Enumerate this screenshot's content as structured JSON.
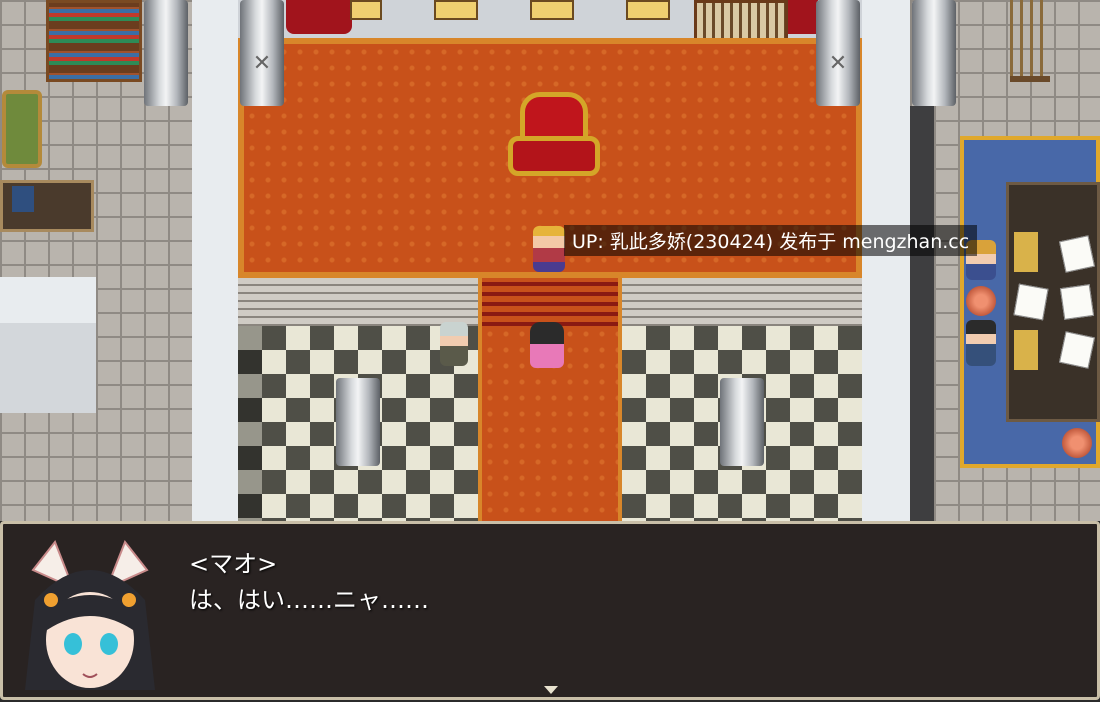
{
  "watermark": {
    "text": "UP: 乳此多娇(230424) 发布于 mengzhan.cc"
  },
  "message": {
    "speaker": "<マオ>",
    "line": "は、はい……ニャ……",
    "portrait_icon": "cat-eared-girl-portrait-icon",
    "continue_icon": "triangle-down-icon"
  },
  "colors": {
    "carpet": "#c8511a",
    "trim": "#d8862a",
    "message_bg": "rgba(40,32,30,.72)"
  }
}
